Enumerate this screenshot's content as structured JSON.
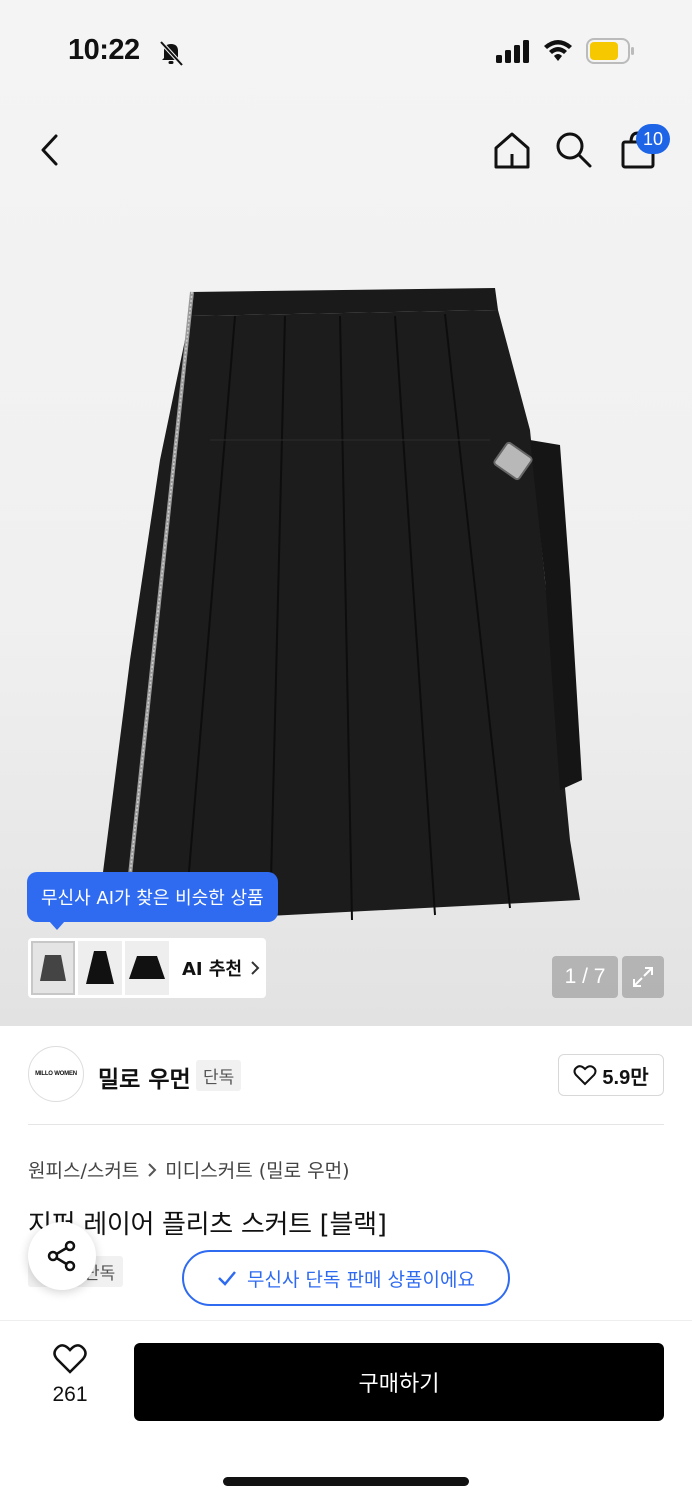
{
  "status_bar": {
    "time": "10:22"
  },
  "header": {
    "cart_count": "10"
  },
  "gallery": {
    "ai_tooltip": "무신사 AI가 찾은 비슷한 상품",
    "ai_label": "AI 추천",
    "page_indicator": "1 / 7"
  },
  "brand": {
    "logo_text": "MILLO WOMEN",
    "name": "밀로 우먼",
    "tag": "단독",
    "likes": "5.9만"
  },
  "product": {
    "breadcrumb": [
      "원피스/스커트",
      "미디스커트 (밀로 우먼)"
    ],
    "title": "지퍼 레이어 플리츠 스커트 [블랙]",
    "tag": "단독",
    "exclusive_notice": "무신사 단독 판매 상품이에요"
  },
  "bottom_bar": {
    "wish_count": "261",
    "buy_label": "구매하기"
  },
  "colors": {
    "accent": "#2f6bf0",
    "badge": "#1e64e6",
    "buy_button": "#000000"
  }
}
